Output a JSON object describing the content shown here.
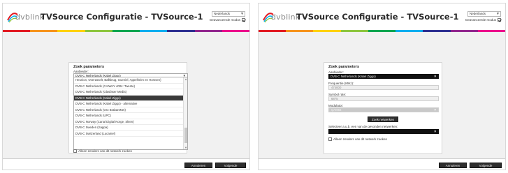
{
  "app": {
    "logo_text": "dvblink",
    "title": "TVSource Configuratie - TVSource-1",
    "language": "Nederlands",
    "advanced_mode_label": "Geavanceerde modus",
    "advanced_mode_checked": true
  },
  "brand_colors": {
    "rainbow": [
      "#e21b23",
      "#f7941d",
      "#ffd200",
      "#8dc63f",
      "#00a651",
      "#00aeef",
      "#2e3192",
      "#92278f",
      "#ec008c"
    ],
    "logo_swirl": [
      "#e21b23",
      "#00aeef",
      "#8dc63f"
    ]
  },
  "left": {
    "panel_title": "Zoek parameters",
    "provider_label": "Aanbieder:",
    "provider_value": "DVB-C Netherlands (Kabel Ziggo)",
    "dropdown_items": [
      "Heunion, Overasselt, Balkbrug, Gueniel, Appelheim en Horssen)",
      "DVB-C Netherlands (CAIWAY 4004: Twente)",
      "DVB-C Netherlands (Glasfaser Media)",
      "DVB-C Netherlands (Kabel Ziggo)",
      "DVB-C Netherlands (Kabel Ziggo) - alternative",
      "DVB-C Netherlands (Oro BrabantNet)",
      "DVB-C Netherlands (UPC)",
      "DVB-C Norway (Canal Digital Norge, Skien)",
      "DVB-C Sweden (Sappa)",
      "DVB-C Switzerland (Lucamel)"
    ],
    "selected_index": 3,
    "network_only_label": "Alleen zenders van dit netwerk zoeken",
    "network_only_checked": false
  },
  "right": {
    "panel_title": "Zoek parameters",
    "provider_label": "Aanbieder:",
    "provider_value": "DVB-C Netherlands (Kabel Ziggo)",
    "frequency_label": "Frequentie (MHz):",
    "frequency_value": "474000",
    "symbol_rate_label": "Symbol rate:",
    "symbol_rate_value": "6875",
    "modulator_label": "Modulator:",
    "modulator_value": "QAM64",
    "scan_networks_button": "Zoek netwerken",
    "select_network_label": "Selecteer a.u.b. een van de gevonden netwerken:",
    "select_network_value": "",
    "network_only_label": "Alleen zenders van dit netwerk zoeken",
    "network_only_checked": false
  },
  "footer": {
    "cancel_label": "Annuleren",
    "next_label": "Volgende"
  }
}
